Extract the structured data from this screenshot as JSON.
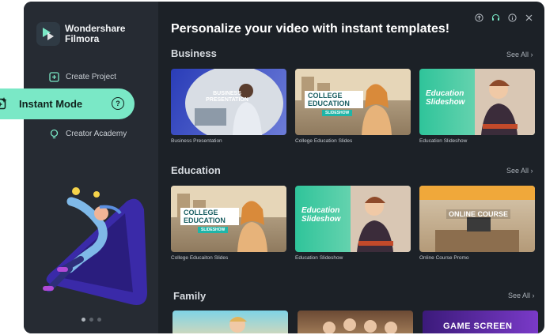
{
  "app": {
    "brand_line1": "Wondershare",
    "brand_line2": "Filmora"
  },
  "sidebar": {
    "items": [
      {
        "label": "Create Project"
      },
      {
        "label": "Instant Mode"
      },
      {
        "label": "Creator Academy"
      }
    ],
    "help_glyph": "?"
  },
  "headline": "Personalize your video with instant templates!",
  "sections": [
    {
      "title": "Business",
      "see_all": "See All",
      "cards": [
        {
          "caption": "Business Presentation",
          "thumb_text": "BUSINESS PRESENTATION"
        },
        {
          "caption": "College Education Slides",
          "thumb_text": "COLLEGE EDUCATION",
          "thumb_sub": "SLIDESHOW"
        },
        {
          "caption": "Education Slideshow",
          "thumb_text": "Education Slideshow"
        }
      ]
    },
    {
      "title": "Education",
      "see_all": "See All",
      "cards": [
        {
          "caption": "College Educaiton Slides",
          "thumb_text": "COLLEGE EDUCATION",
          "thumb_sub": "SLIDESHOW"
        },
        {
          "caption": "Education Slideshow",
          "thumb_text": "Education Slideshow"
        },
        {
          "caption": "Online Course Promo",
          "thumb_text": "ONLINE COURSE"
        }
      ]
    },
    {
      "title": "Family",
      "see_all": "See All",
      "cards": [
        {
          "thumb_text": ""
        },
        {
          "thumb_text": ""
        },
        {
          "thumb_text": "GAME SCREEN"
        }
      ]
    }
  ],
  "colors": {
    "accent": "#7ae8c6",
    "window_bg": "#1c2127",
    "sidebar_bg": "#262b33"
  },
  "icons": [
    "upload-icon",
    "headset-icon",
    "info-icon",
    "close-icon"
  ]
}
